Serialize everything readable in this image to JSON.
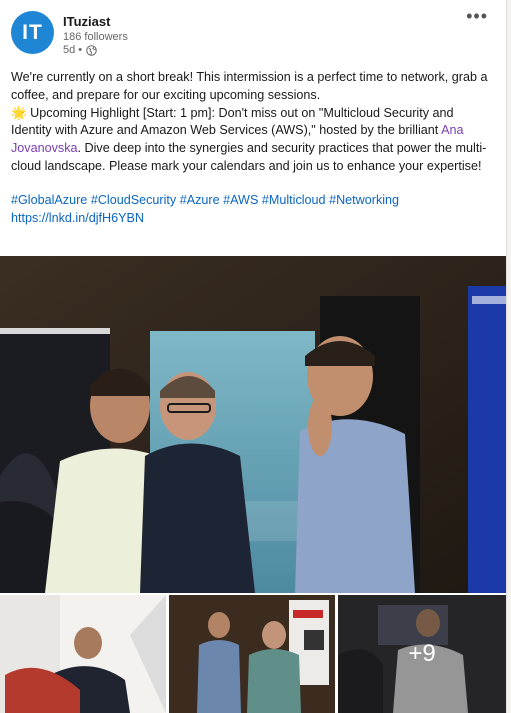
{
  "post": {
    "author_initials": "IT",
    "author_name": "ITuziast",
    "followers": "186 followers",
    "age": "5d •",
    "more_icon": "more-horizontal-icon",
    "visibility_icon": "globe-icon"
  },
  "content": {
    "para1": "We're currently on a short break! This intermission is a perfect time to network, grab a coffee, and prepare for our exciting upcoming sessions.",
    "highlight_emoji": "🌟",
    "highlight_pre": " Upcoming Highlight [Start: 1 pm]: Don't miss out on \"Multicloud Security and Identity with Azure and Amazon Web Services (AWS),\" hosted by the brilliant ",
    "mention": "Ana Jovanovska",
    "highlight_post": ". Dive deep into the synergies and security practices that power the multi-cloud landscape. Please mark your calendars and join us to enhance your expertise!",
    "hashtags": [
      "#GlobalAzure",
      "#CloudSecurity",
      "#Azure",
      "#AWS",
      "#Multicloud",
      "#Networking"
    ],
    "link": "https://lnkd.in/djfH6YBN"
  },
  "media": {
    "more_count": "+9"
  },
  "colors": {
    "avatar": "#1f86d6",
    "link": "#0a66c2",
    "mention": "#7a3fb0"
  }
}
